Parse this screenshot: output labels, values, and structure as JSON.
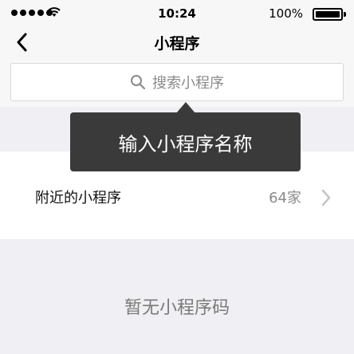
{
  "status_bar": {
    "time": "10:24",
    "battery": "100%",
    "signal_icon": "signal-dots-icon",
    "wifi_icon": "wifi-icon",
    "battery_icon": "battery-icon"
  },
  "nav": {
    "title": "小程序",
    "back_icon": "chevron-left-icon"
  },
  "search": {
    "placeholder": "搜索小程序",
    "icon": "search-icon"
  },
  "tooltip": {
    "text": "输入小程序名称"
  },
  "list": {
    "items": [
      {
        "label": "附近的小程序",
        "value": "64家",
        "icon": "chevron-right-icon"
      }
    ]
  },
  "empty_state": {
    "text": "暂无小程序码"
  },
  "colors": {
    "background": "#efeff4",
    "bar": "#f7f7f7",
    "tooltip": "#3a3a3a",
    "secondary_text": "#8a8a8a"
  }
}
